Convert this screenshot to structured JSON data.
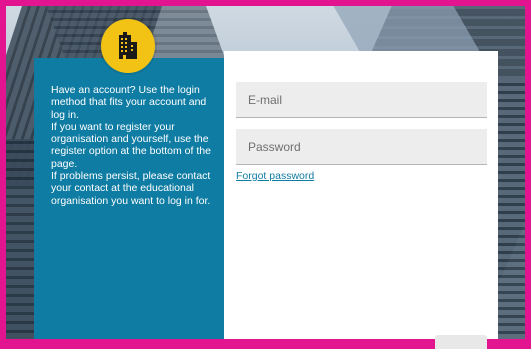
{
  "panel": {
    "info_text": "Have an account? Use the login method that fits your account and log in.\nIf you want to register your organisation and yourself, use the register option at the bottom of the page.\nIf problems persist, please contact your contact at the educational organisation you want to log in for."
  },
  "form": {
    "email_placeholder": "E-mail",
    "password_placeholder": "Password",
    "forgot_label": "Forgot password"
  },
  "logo": {
    "icon": "building-icon"
  },
  "colors": {
    "frame": "#e2148f",
    "panel": "#0f7ca3",
    "logo": "#f2c314",
    "link": "#0f7ca3"
  }
}
